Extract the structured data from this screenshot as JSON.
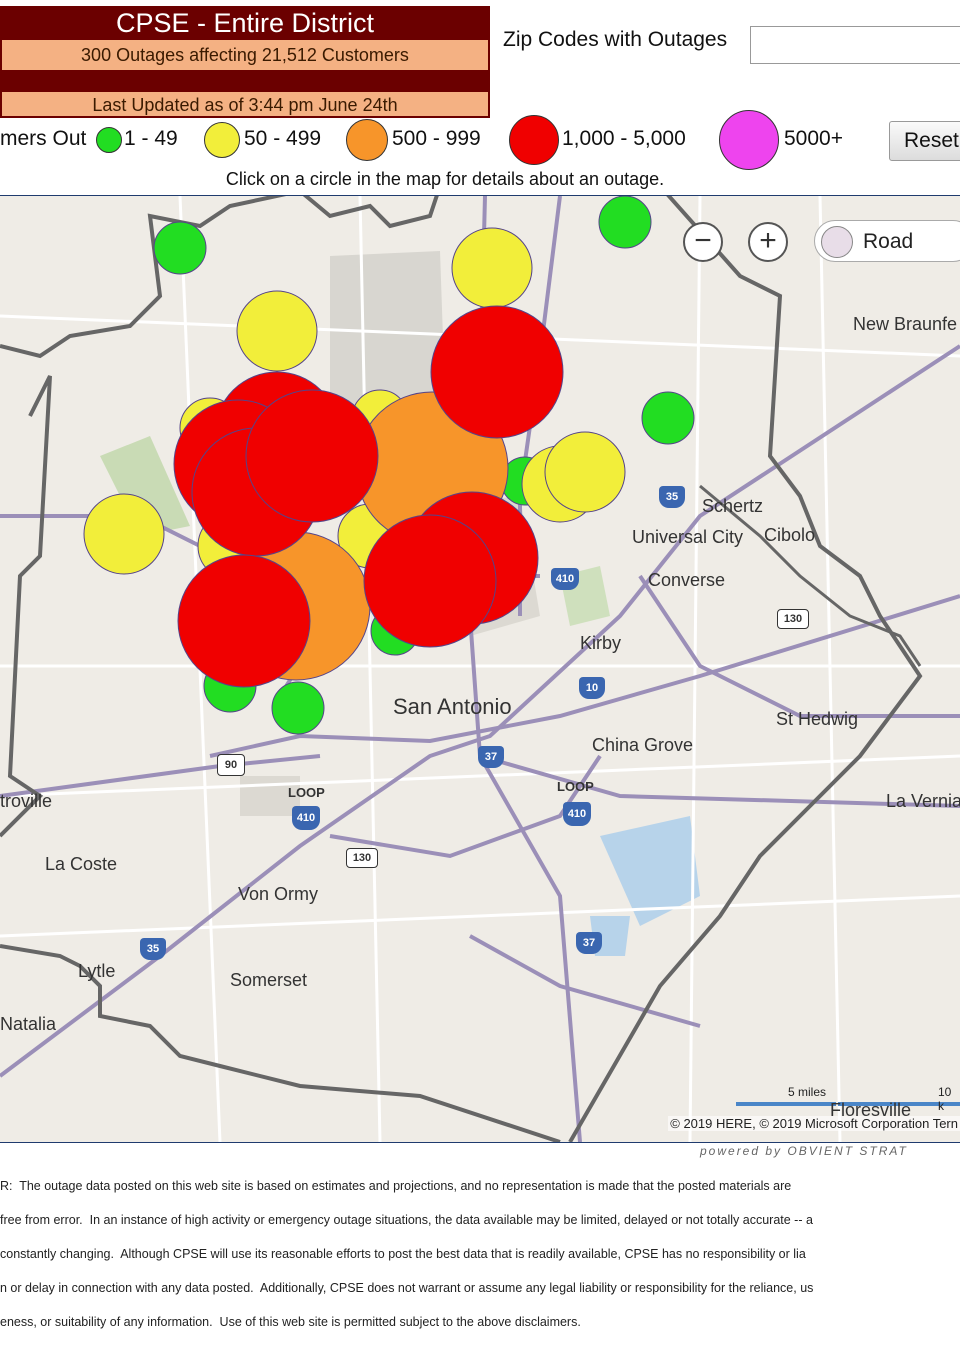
{
  "header": {
    "title": "CPSE - Entire District",
    "outage_summary": "300 Outages affecting 21,512 Customers",
    "last_updated": "Last Updated as of 3:44 pm June 24th"
  },
  "zip_search": {
    "label": "Zip Codes with Outages",
    "value": ""
  },
  "legend": {
    "lead_label": "mers Out",
    "items": [
      {
        "label": "1 - 49",
        "color": "#22dd22"
      },
      {
        "label": "50 - 499",
        "color": "#f2ee3a"
      },
      {
        "label": "500 - 999",
        "color": "#f7952a"
      },
      {
        "label": "1,000 - 5,000",
        "color": "#f00000"
      },
      {
        "label": "5000+",
        "color": "#ee44ee"
      }
    ],
    "reset_label": "Reset"
  },
  "hint": "Click on a circle in the map for details about an outage.",
  "map_controls": {
    "zoom_out": "−",
    "zoom_in": "+",
    "map_type": "Road"
  },
  "places": [
    "New Braunfe",
    "Schertz",
    "Universal City",
    "Cibolo",
    "Converse",
    "Kirby",
    "San Antonio",
    "St Hedwig",
    "China Grove",
    "troville",
    "La Vernia",
    "La Coste",
    "Von Ormy",
    "Lytle",
    "Somerset",
    "Natalia",
    "Floresville"
  ],
  "highway_shields": [
    "35",
    "410",
    "130",
    "10",
    "90",
    "37",
    "410",
    "410",
    "130",
    "35",
    "37"
  ],
  "loop_labels": [
    "LOOP",
    "LOOP"
  ],
  "scale": {
    "miles_label": "5 miles",
    "km_label": "10 k"
  },
  "copyright": "© 2019 HERE, © 2019 Microsoft Corporation  Tern",
  "powered_by": "powered by OBVIENT STRAT",
  "disclaimer": [
    "R:  The outage data posted on this web site is based on estimates and projections, and no representation is made that the posted materials are",
    "free from error.  In an instance of high activity or emergency outage situations, the data available may be limited, delayed or not totally accurate -- a",
    "constantly changing.  Although CPSE will use its reasonable efforts to post the best data that is readily available, CPSE has no responsibility or lia",
    "n or delay in connection with any data posted.  Additionally, CPSE does not warrant or assume any legal liability or responsibility for the reliance, us",
    "eness, or suitability of any information.  Use of this web site is permitted subject to the above disclaimers."
  ]
}
